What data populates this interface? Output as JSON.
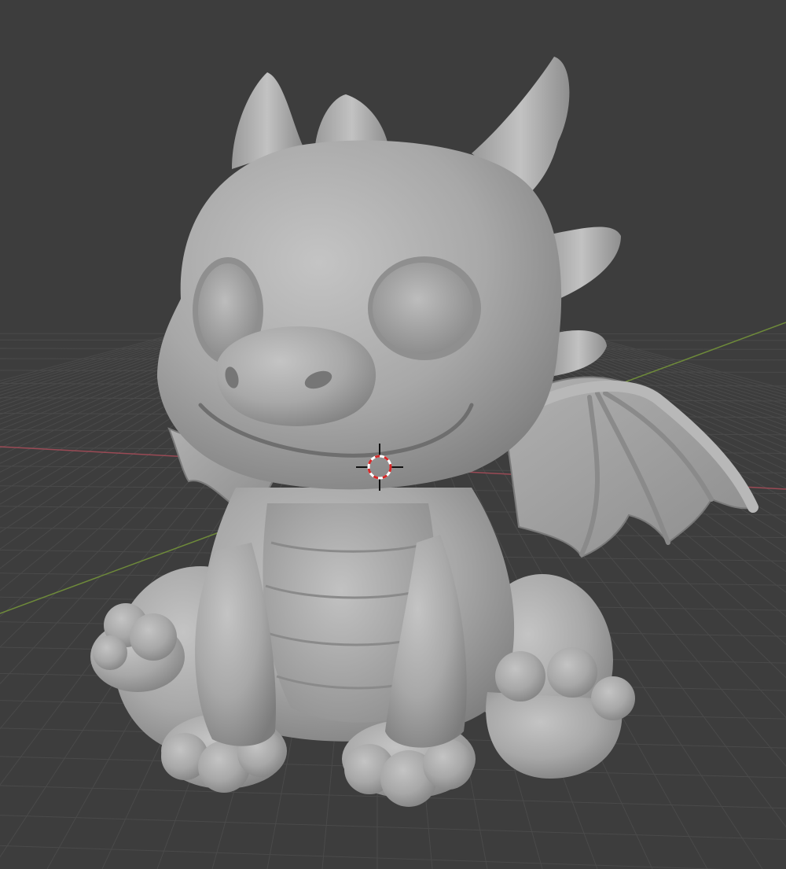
{
  "app": {
    "name": "",
    "view_label": ""
  },
  "viewport": {
    "background_color": "#3d3d3d",
    "grid_color": "#4a4a4a",
    "x_axis_color": "#9a4a55",
    "y_axis_color": "#6e8a3a",
    "show_grid": true,
    "show_axes": true,
    "shading_mode": "solid"
  },
  "scene": {
    "active_object": "dragon-model",
    "object_material_color": "#a9a9a9",
    "cursor_icon": "3d-cursor-icon"
  }
}
